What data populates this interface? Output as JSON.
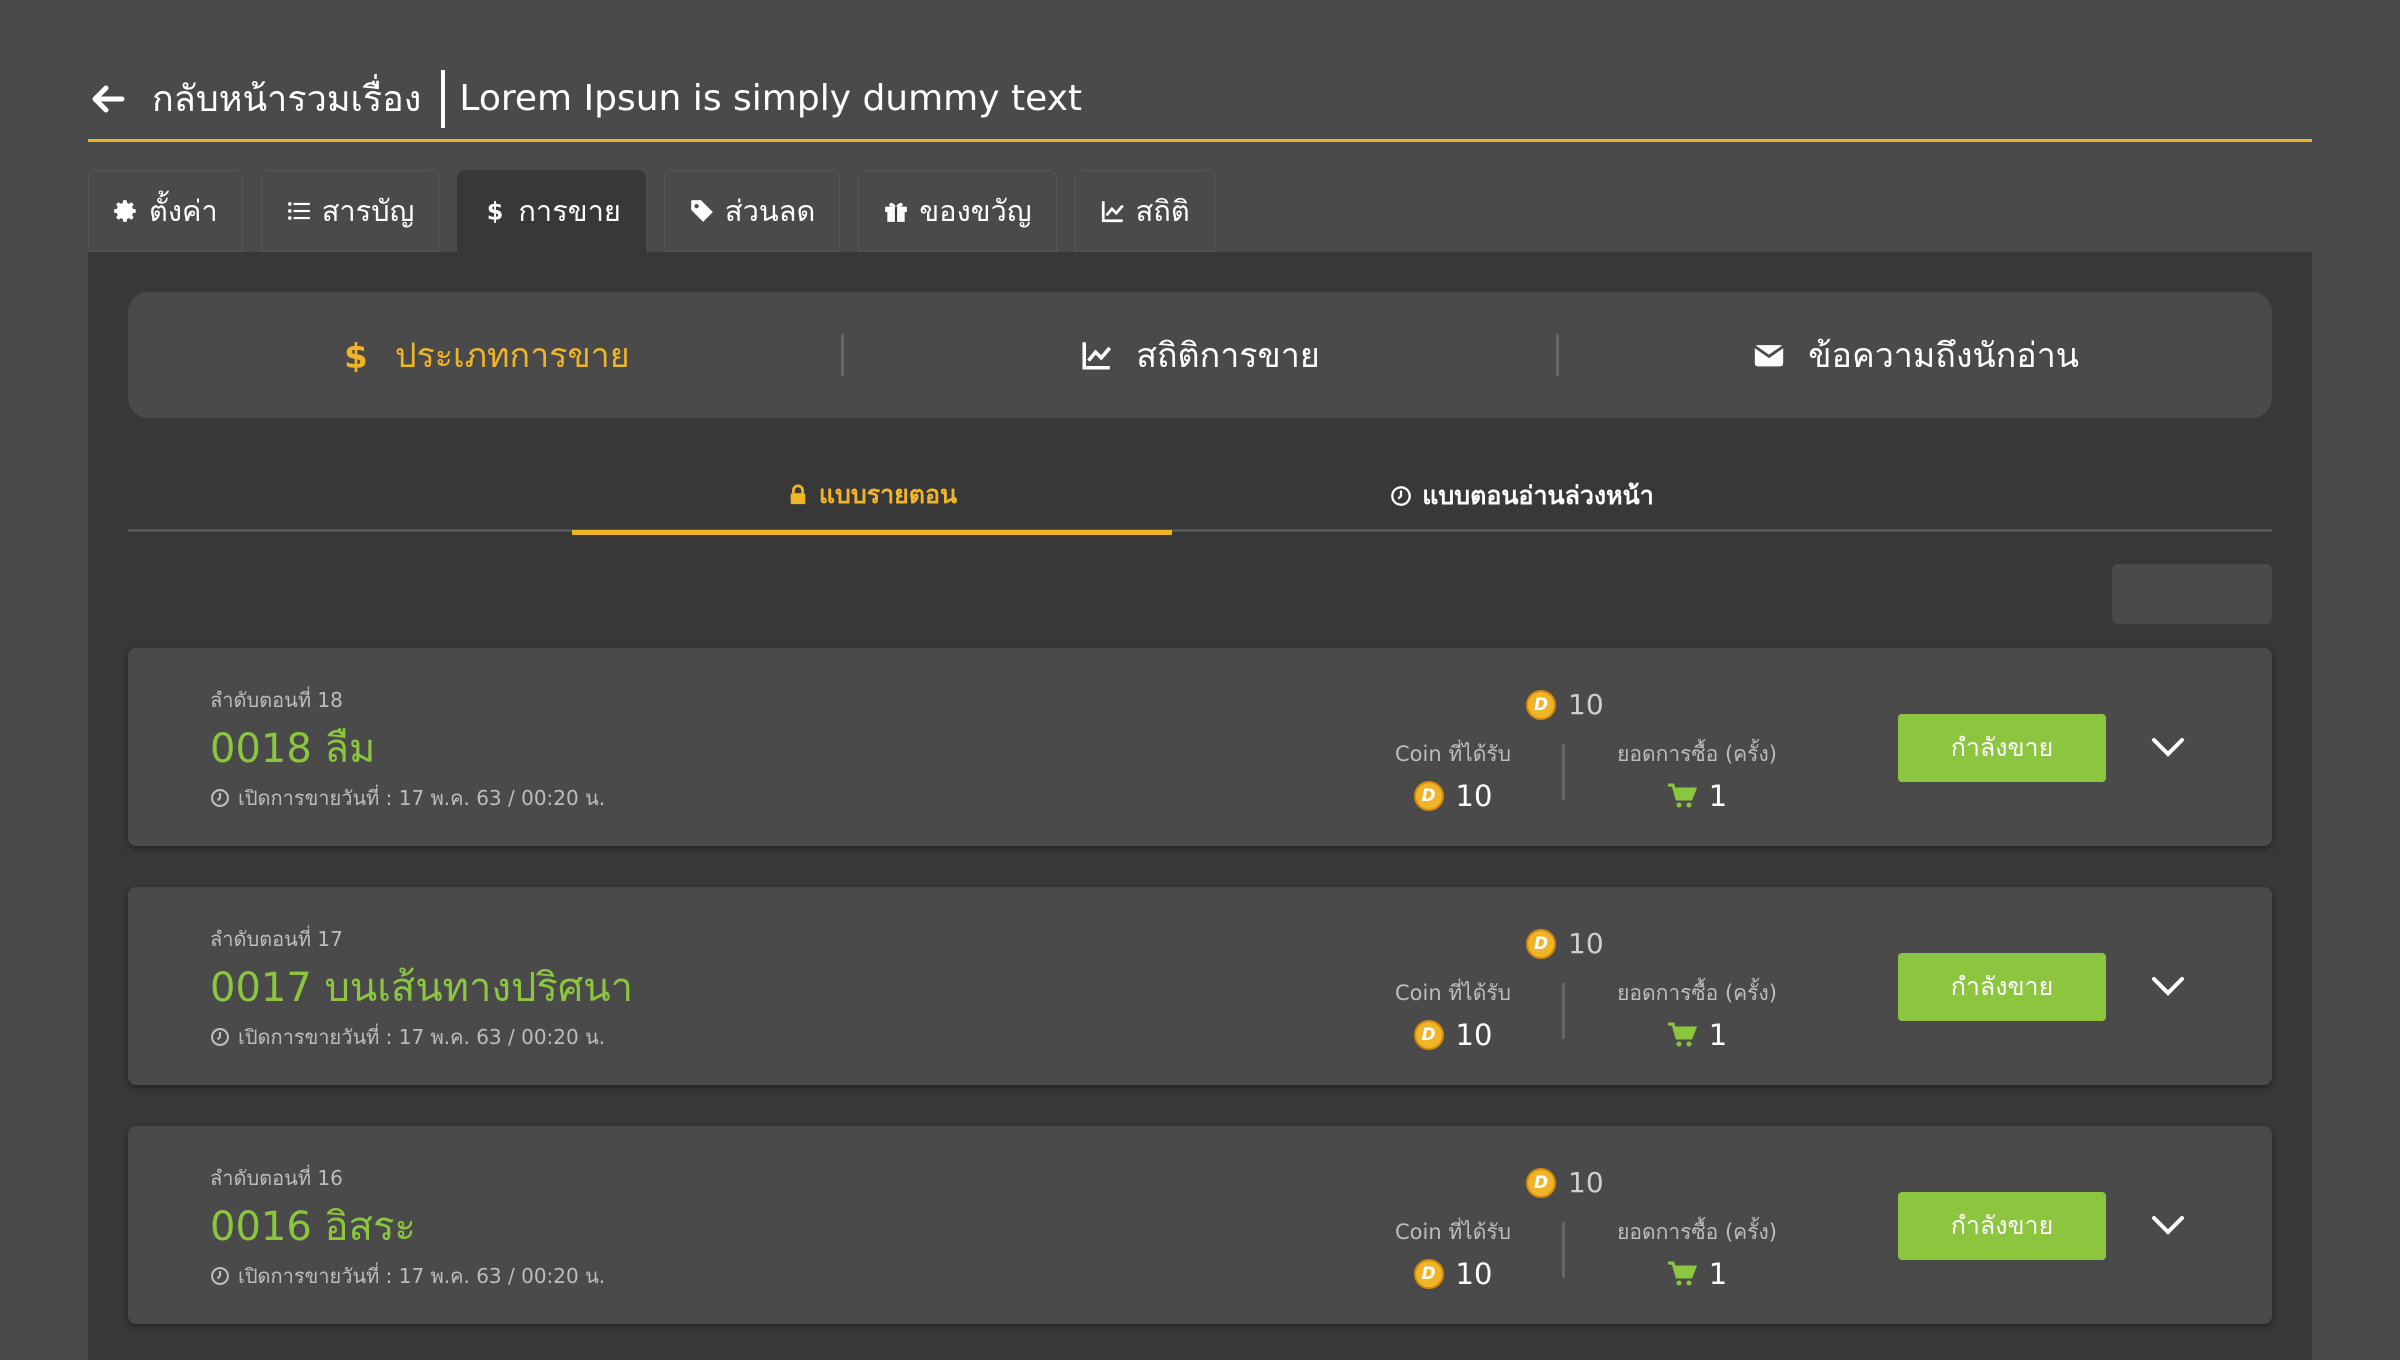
{
  "header": {
    "back_label": "กลับหน้ารวมเรื่อง",
    "title": "Lorem Ipsun is simply dummy text"
  },
  "tabs": [
    {
      "label": "ตั้งค่า",
      "icon": "gear-icon"
    },
    {
      "label": "สารบัญ",
      "icon": "list-icon"
    },
    {
      "label": "การขาย",
      "icon": "dollar-icon",
      "active": true
    },
    {
      "label": "ส่วนลด",
      "icon": "tag-icon"
    },
    {
      "label": "ของขวัญ",
      "icon": "gift-icon"
    },
    {
      "label": "สถิติ",
      "icon": "chart-icon"
    }
  ],
  "subnav": [
    {
      "label": "ประเภทการขาย",
      "icon": "dollar-icon",
      "active": true
    },
    {
      "label": "สถิติการขาย",
      "icon": "chart-icon"
    },
    {
      "label": "ข้อความถึงนักอ่าน",
      "icon": "envelope-icon"
    }
  ],
  "mode_tabs": [
    {
      "label": "แบบรายตอน",
      "icon": "lock-icon",
      "active": true
    },
    {
      "label": "แบบตอนอ่านล่วงหน้า",
      "icon": "clock-icon"
    }
  ],
  "stat_labels": {
    "coin": "Coin ที่ได้รับ",
    "purchases": "ยอดการซื้อ (ครั้ง)"
  },
  "episodes": [
    {
      "order": "ลำดับตอนที่ 18",
      "title": "0018 ลืม",
      "date": "เปิดการขายวันที่ :  17 พ.ค. 63 / 00:20 น.",
      "price": "10",
      "coins": "10",
      "purchases": "1",
      "status": "กำลังขาย"
    },
    {
      "order": "ลำดับตอนที่ 17",
      "title": "0017 บนเส้นทางปริศนา",
      "date": "เปิดการขายวันที่ :  17 พ.ค. 63 / 00:20 น.",
      "price": "10",
      "coins": "10",
      "purchases": "1",
      "status": "กำลังขาย"
    },
    {
      "order": "ลำดับตอนที่ 16",
      "title": "0016 อิสระ",
      "date": "เปิดการขายวันที่ :  17 พ.ค. 63 / 00:20 น.",
      "price": "10",
      "coins": "10",
      "purchases": "1",
      "status": "กำลังขาย"
    }
  ],
  "coin_glyph": "D",
  "colors": {
    "accent": "#f0b429",
    "success": "#8cc63f",
    "background": "#4a4a4a",
    "panel": "#383838"
  }
}
